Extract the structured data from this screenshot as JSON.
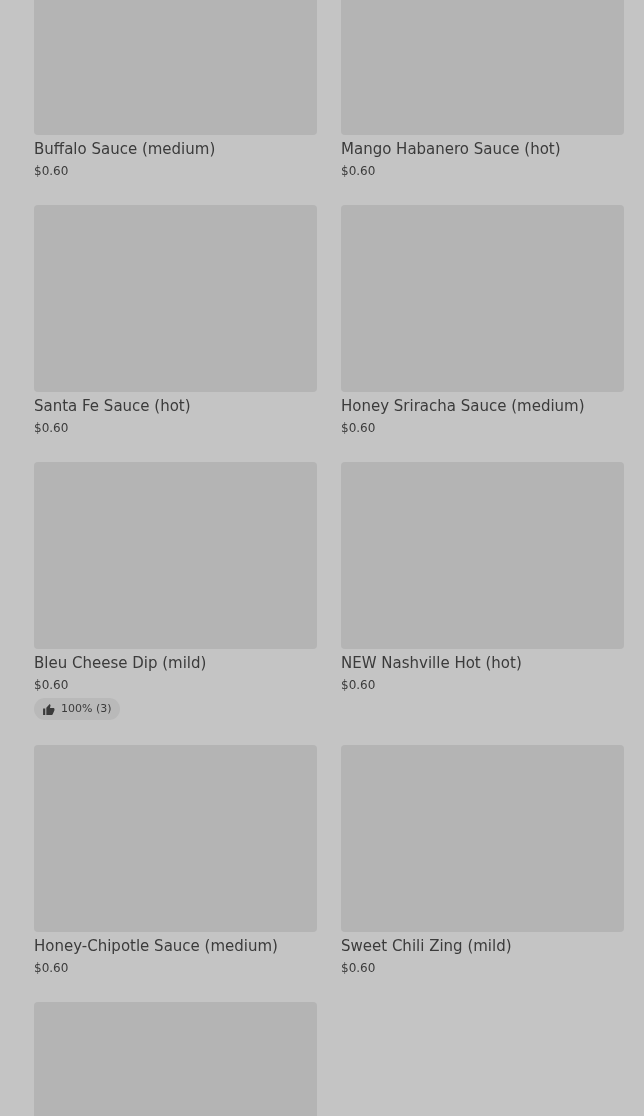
{
  "products": [
    {
      "kind": "card",
      "name": "Buffalo Sauce (medium)",
      "price": "$0.60"
    },
    {
      "kind": "card",
      "name": "Mango Habanero Sauce (hot)",
      "price": "$0.60"
    },
    {
      "kind": "card",
      "name": "Santa Fe Sauce (hot)",
      "price": "$0.60"
    },
    {
      "kind": "card",
      "name": "Honey Sriracha Sauce (medium)",
      "price": "$0.60"
    },
    {
      "kind": "card",
      "name": "Bleu Cheese Dip (mild)",
      "price": "$0.60",
      "rating": "100% (3)"
    },
    {
      "kind": "card",
      "name": "NEW Nashville Hot (hot)",
      "price": "$0.60"
    },
    {
      "kind": "card",
      "name": "Honey-Chipotle Sauce (medium)",
      "price": "$0.60"
    },
    {
      "kind": "card",
      "name": "Sweet Chili Zing (mild)",
      "price": "$0.60"
    },
    {
      "kind": "image"
    }
  ]
}
